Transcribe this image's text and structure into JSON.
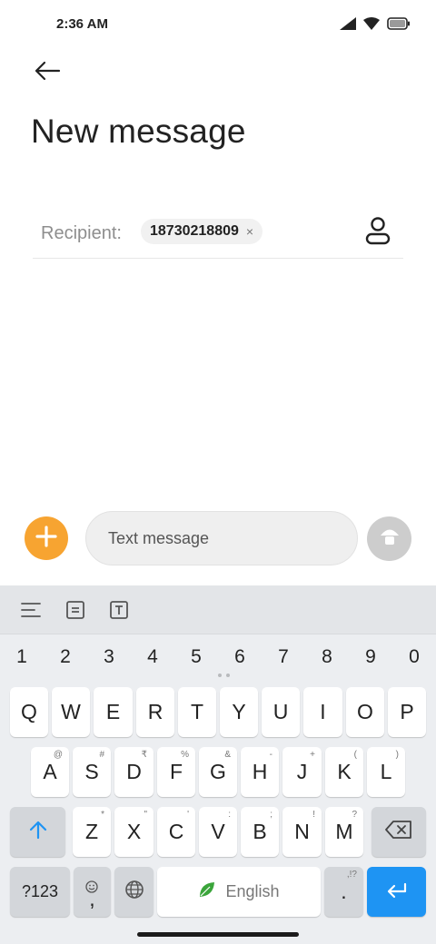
{
  "status_bar": {
    "time": "2:36 AM"
  },
  "header": {
    "title": "New message"
  },
  "recipient": {
    "label": "Recipient:",
    "chip_text": "18730218809",
    "chip_close": "×"
  },
  "compose": {
    "placeholder": "Text message"
  },
  "keyboard": {
    "numbers": [
      "1",
      "2",
      "3",
      "4",
      "5",
      "6",
      "7",
      "8",
      "9",
      "0"
    ],
    "row1": [
      "Q",
      "W",
      "E",
      "R",
      "T",
      "Y",
      "U",
      "I",
      "O",
      "P"
    ],
    "row2": [
      {
        "key": "A",
        "hint": "@"
      },
      {
        "key": "S",
        "hint": "#"
      },
      {
        "key": "D",
        "hint": "₹"
      },
      {
        "key": "F",
        "hint": "%"
      },
      {
        "key": "G",
        "hint": "&"
      },
      {
        "key": "H",
        "hint": "-"
      },
      {
        "key": "J",
        "hint": "+"
      },
      {
        "key": "K",
        "hint": "("
      },
      {
        "key": "L",
        "hint": ")"
      }
    ],
    "row3": [
      {
        "key": "Z",
        "hint": "*"
      },
      {
        "key": "X",
        "hint": "\""
      },
      {
        "key": "C",
        "hint": "'"
      },
      {
        "key": "V",
        "hint": ":"
      },
      {
        "key": "B",
        "hint": ";"
      },
      {
        "key": "N",
        "hint": "!"
      },
      {
        "key": "M",
        "hint": "?"
      }
    ],
    "symbols_label": "?123",
    "comma_label": ",",
    "space_label": "English",
    "period_label": ".",
    "period_hint": ",!?"
  },
  "colors": {
    "accent_orange": "#f7a431",
    "enter_blue": "#1e94f3",
    "send_disabled": "#cdcdcd"
  }
}
